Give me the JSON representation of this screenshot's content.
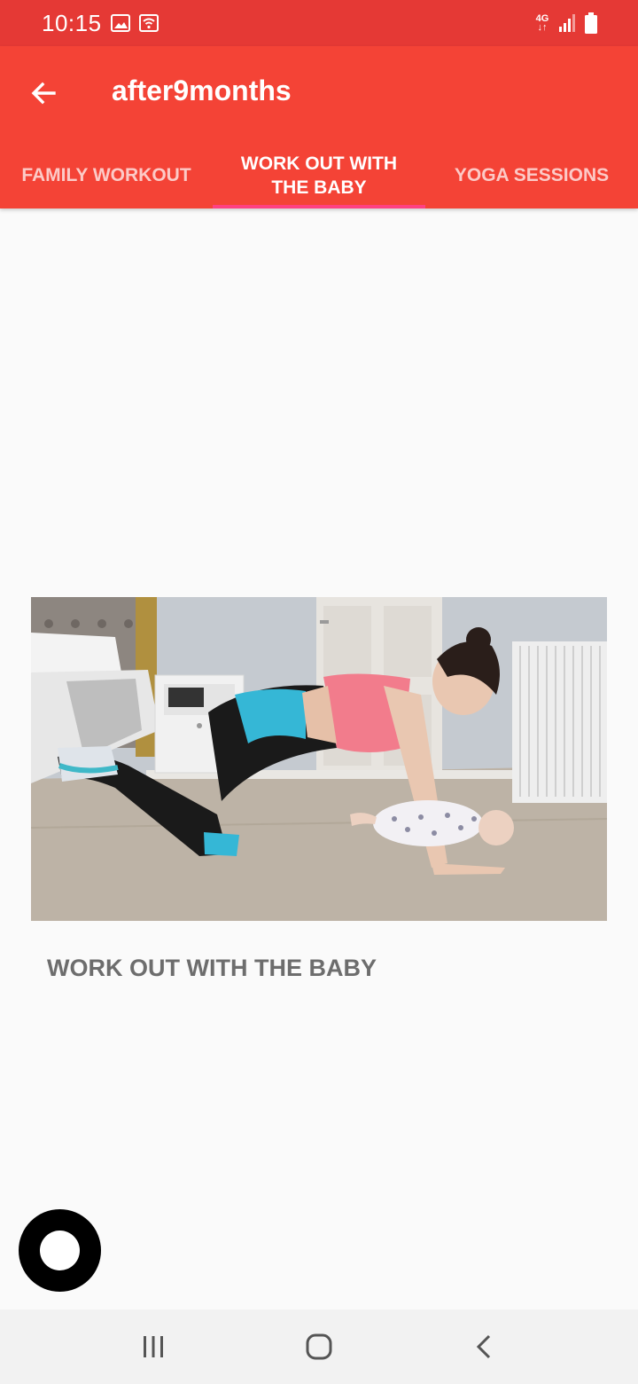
{
  "status_bar": {
    "time": "10:15",
    "icons": [
      "image-icon",
      "wifi-icon"
    ],
    "network": "4G",
    "right_icons": [
      "signal-icon",
      "battery-icon"
    ]
  },
  "app_bar": {
    "title": "after9months",
    "back_icon": "arrow-left-icon"
  },
  "tabs": [
    {
      "label": "FAMILY WORKOUT",
      "active": false
    },
    {
      "label": "WORK OUT WITH THE BABY",
      "active": true
    },
    {
      "label": "YOGA SESSIONS",
      "active": false
    }
  ],
  "video": {
    "title": "WORK OUT WITH THE BABY"
  },
  "fab": {
    "icon": "record-icon"
  },
  "nav_bar": {
    "items": [
      "recent-apps-icon",
      "home-icon",
      "back-icon"
    ]
  },
  "colors": {
    "status_bar": "#e53935",
    "app_bar": "#f44336",
    "tab_indicator": "#ff4081",
    "title_text": "#6d6d6d"
  }
}
